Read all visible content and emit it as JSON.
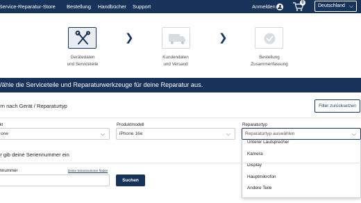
{
  "nav": {
    "brand": "-Service-Reparatur-Store",
    "items": [
      "Bestellung",
      "Handbücher",
      "Support"
    ],
    "login": "Anmelden",
    "cart_count": "0",
    "country": "Deutschland"
  },
  "steps": [
    {
      "line1": "Gerätedaten",
      "line2": "und Serviceteile",
      "icon": "tools-icon",
      "active": true
    },
    {
      "line1": "Kundendaten",
      "line2": "und Versand",
      "icon": "truck-icon",
      "active": false
    },
    {
      "line1": "Bestellung",
      "line2": "Zusammenfassung",
      "icon": "check-icon",
      "active": false
    }
  ],
  "banner": "Wähle die Serviceteile und Reparaturwerkzeuge für deine Reparatur aus.",
  "filter": {
    "title": "ern nach Gerät / Reparaturtyp",
    "reset_label": "Filter zurücksetzen",
    "product_label": "ukt",
    "product_value": "one",
    "model_label": "Produktmodell",
    "model_value": "iPhone 16e",
    "repair_label": "Reparaturtyp",
    "repair_placeholder": "Reparaturtyp auswählen"
  },
  "dropdown_options": [
    "Unterer Lautsprecher",
    "Kamera",
    "Display",
    "Hauptmikrofon",
    "Andere Teile"
  ],
  "serial": {
    "title": "er gib deine Seriennummer ein",
    "label": "ennummer",
    "link": "Deine Seriennummer finden",
    "button": "Suchen"
  },
  "colors": {
    "primary": "#18335a",
    "border": "#c9cdd2"
  }
}
